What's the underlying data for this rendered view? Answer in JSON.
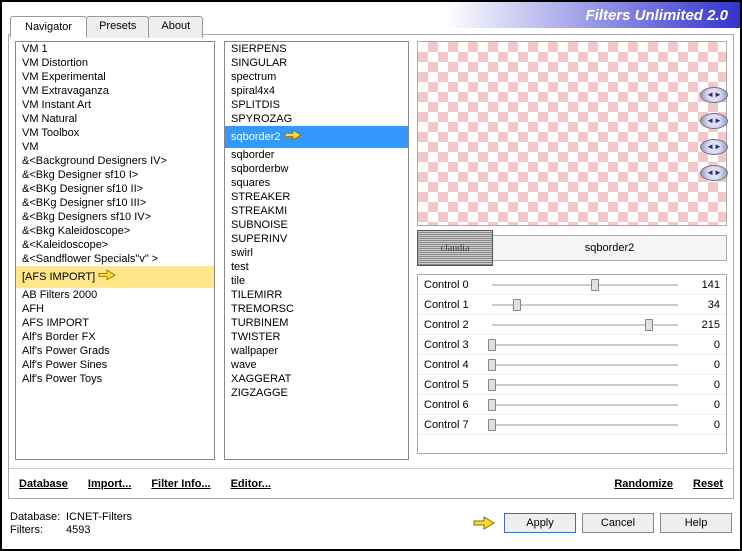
{
  "header": {
    "title": "Filters Unlimited 2.0"
  },
  "tabs": {
    "navigator": "Navigator",
    "presets": "Presets",
    "about": "About"
  },
  "left_list": {
    "items": [
      "VM 1",
      "VM Distortion",
      "VM Experimental",
      "VM Extravaganza",
      "VM Instant Art",
      "VM Natural",
      "VM Toolbox",
      "VM",
      "&<Background Designers IV>",
      "&<Bkg Designer sf10 I>",
      "&<BKg Designer sf10 II>",
      "&<BKg Designer sf10 III>",
      "&<Bkg Designers sf10 IV>",
      "&<Bkg Kaleidoscope>",
      "&<Kaleidoscope>",
      "&<Sandflower Specials\"v\" >",
      "[AFS IMPORT]",
      "AB Filters 2000",
      "AFH",
      "AFS IMPORT",
      "Alf's Border FX",
      "Alf's Power Grads",
      "Alf's Power Sines",
      "Alf's Power Toys"
    ],
    "highlighted_index": 16
  },
  "middle_list": {
    "items": [
      "SIERPENS",
      "SINGULAR",
      "spectrum",
      "spiral4x4",
      "SPLITDIS",
      "SPYROZAG",
      "sqborder2",
      "sqborder",
      "sqborderbw",
      "squares",
      "STREAKER",
      "STREAKMI",
      "SUBNOISE",
      "SUPERINV",
      "swirl",
      "test",
      "tile",
      "TILEMIRR",
      "TREMORSC",
      "TURBINEM",
      "TWISTER",
      "wallpaper",
      "wave",
      "XAGGERAT",
      "ZIGZAGGE"
    ],
    "selected_index": 6
  },
  "content_bottom": {
    "database": "Database",
    "import": "Import...",
    "filter_info": "Filter Info...",
    "editor": "Editor...",
    "randomize": "Randomize",
    "reset": "Reset"
  },
  "logo_row": {
    "logo_text": "claudia",
    "filter_name": "sqborder2"
  },
  "controls": [
    {
      "label": "Control 0",
      "value": 141,
      "max": 255
    },
    {
      "label": "Control 1",
      "value": 34,
      "max": 255
    },
    {
      "label": "Control 2",
      "value": 215,
      "max": 255
    },
    {
      "label": "Control 3",
      "value": 0,
      "max": 255
    },
    {
      "label": "Control 4",
      "value": 0,
      "max": 255
    },
    {
      "label": "Control 5",
      "value": 0,
      "max": 255
    },
    {
      "label": "Control 6",
      "value": 0,
      "max": 255
    },
    {
      "label": "Control 7",
      "value": 0,
      "max": 255
    }
  ],
  "status": {
    "database_label": "Database:",
    "database_value": "ICNET-Filters",
    "filters_label": "Filters:",
    "filters_value": "4593"
  },
  "buttons": {
    "apply": "Apply",
    "cancel": "Cancel",
    "help": "Help"
  }
}
